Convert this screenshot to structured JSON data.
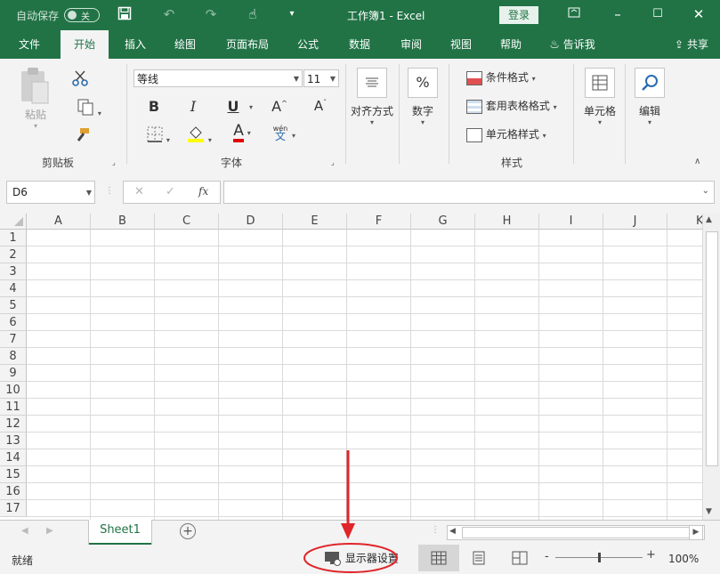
{
  "titlebar": {
    "autosave_label": "自动保存",
    "autosave_state": "关",
    "doc_title": "工作簿1  -  Excel",
    "login_label": "登录"
  },
  "tabs": [
    {
      "label": "文件"
    },
    {
      "label": "开始"
    },
    {
      "label": "插入"
    },
    {
      "label": "绘图"
    },
    {
      "label": "页面布局"
    },
    {
      "label": "公式"
    },
    {
      "label": "数据"
    },
    {
      "label": "审阅"
    },
    {
      "label": "视图"
    },
    {
      "label": "帮助"
    },
    {
      "label": "告诉我"
    }
  ],
  "share_label": "共享",
  "ribbon": {
    "clipboard": {
      "paste": "粘贴",
      "group": "剪贴板"
    },
    "font": {
      "font_name": "等线",
      "font_size": "11",
      "bold": "B",
      "italic": "I",
      "underline": "U",
      "grow": "A",
      "shrink": "A",
      "font_color_glyph": "A",
      "phonetic_top": "wén",
      "phonetic_bottom": "文",
      "group": "字体"
    },
    "alignment": {
      "label": "对齐方式"
    },
    "number": {
      "label": "数字",
      "glyph": "%"
    },
    "styles": {
      "conditional": "条件格式",
      "table_format": "套用表格格式",
      "cell_styles": "单元格样式",
      "group": "样式"
    },
    "cells": {
      "label": "单元格"
    },
    "editing": {
      "label": "编辑"
    }
  },
  "formula_bar": {
    "name_box": "D6",
    "cancel": "✕",
    "enter": "✓",
    "fx": "fx",
    "content": ""
  },
  "grid": {
    "columns": [
      "A",
      "B",
      "C",
      "D",
      "E",
      "F",
      "G",
      "H",
      "I",
      "J",
      "K"
    ],
    "rows": [
      "1",
      "2",
      "3",
      "4",
      "5",
      "6",
      "7",
      "8",
      "9",
      "10",
      "11",
      "12",
      "13",
      "14",
      "15",
      "16",
      "17"
    ]
  },
  "sheets": [
    {
      "label": "Sheet1",
      "active": true
    }
  ],
  "add_sheet": "+",
  "status": {
    "ready": "就绪",
    "display_settings": "显示器设置",
    "zoom_minus": "-",
    "zoom_plus": "+",
    "zoom": "100%",
    "zoom_level_fraction": 0.5
  },
  "colors": {
    "brand": "#217346",
    "annotation": "#e0252a"
  }
}
